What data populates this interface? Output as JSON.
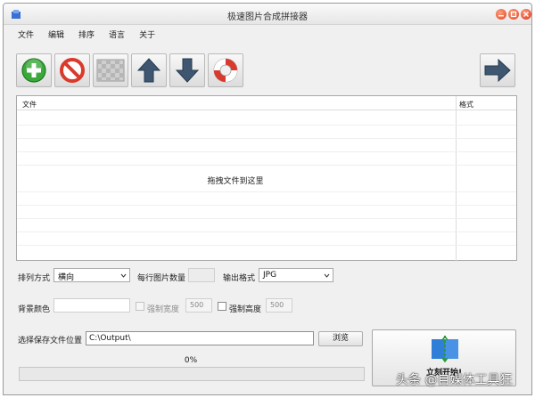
{
  "window": {
    "title": "极速图片合成拼接器"
  },
  "menu": {
    "items": [
      "文件",
      "编辑",
      "排序",
      "语言",
      "关于"
    ]
  },
  "toolbar": {
    "buttons": [
      {
        "name": "add-icon"
      },
      {
        "name": "remove-icon"
      },
      {
        "name": "clear-icon"
      },
      {
        "name": "move-up-icon"
      },
      {
        "name": "move-down-icon"
      },
      {
        "name": "help-icon"
      },
      {
        "name": "next-icon"
      }
    ]
  },
  "file_list": {
    "columns": [
      "文件",
      "格式"
    ],
    "drop_hint": "拖拽文件到这里"
  },
  "options": {
    "arrange_label": "排列方式",
    "arrange_value": "横向",
    "per_row_label": "每行图片数量",
    "output_format_label": "输出格式",
    "output_format_value": "JPG",
    "bg_color_label": "背景颜色",
    "force_width_label": "强制宽度",
    "force_width_value": "500",
    "force_height_label": "强制高度",
    "force_height_value": "500"
  },
  "save": {
    "label": "选择保存文件位置",
    "path": "C:\\Output\\",
    "browse_label": "浏览"
  },
  "progress": {
    "text": "0%",
    "value": 0
  },
  "start": {
    "label": "立刻开始!"
  },
  "watermark": {
    "text": "头条 @自媒体工具狂"
  },
  "colors": {
    "accent": "#2f7fd8",
    "add_green": "#3aa83a",
    "stop_red": "#d93a2b"
  }
}
